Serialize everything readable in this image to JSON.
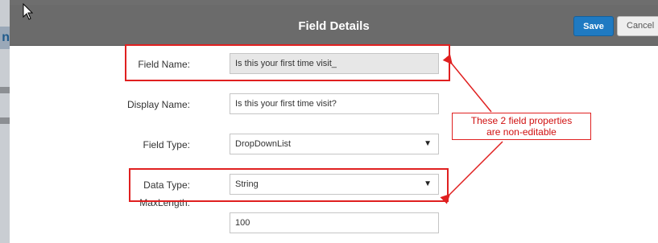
{
  "app": {
    "sidebar_glyph": "n"
  },
  "modal": {
    "title": "Field Details",
    "save_label": "Save",
    "cancel_label": "Cancel"
  },
  "form": {
    "field_name": {
      "label": "Field Name:",
      "value": "Is this your first time visit_"
    },
    "display_name": {
      "label": "Display Name:",
      "value": "Is this your first time visit?"
    },
    "field_type": {
      "label": "Field Type:",
      "value": "DropDownList"
    },
    "data_type": {
      "label": "Data Type:",
      "value": "String"
    },
    "max_length": {
      "label": "MaxLength:",
      "value": "100"
    }
  },
  "annotation": {
    "line1": "These 2 field properties",
    "line2": "are non-editable",
    "color": "#e02020"
  },
  "colors": {
    "header_bg": "#6b6b6b",
    "save_bg": "#1f7ac2",
    "disabled_input_bg": "#e7e7e7"
  },
  "icons": {
    "cursor": "mouse-pointer-icon",
    "dropdown": "triangle-down-icon"
  }
}
